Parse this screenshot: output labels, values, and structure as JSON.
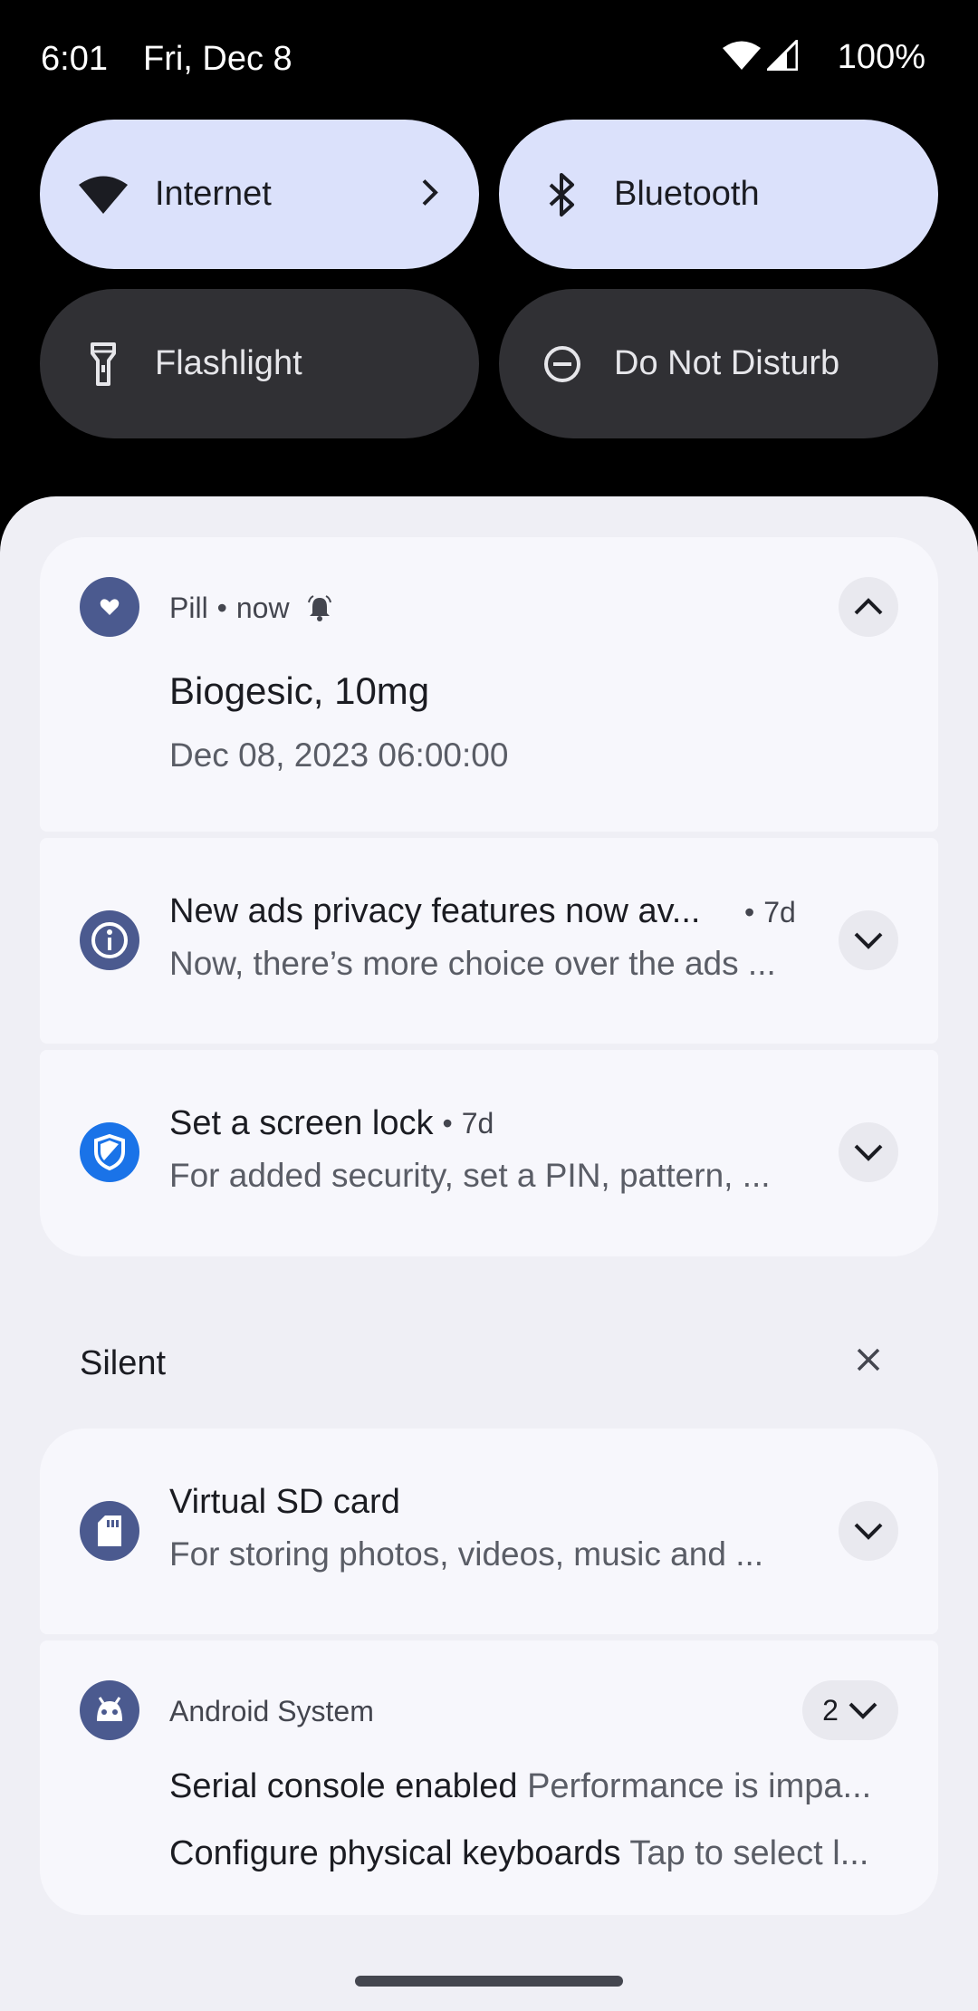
{
  "status_bar": {
    "time": "6:01",
    "date": "Fri, Dec 8",
    "battery": "100%"
  },
  "quick_settings": {
    "internet": {
      "label": "Internet",
      "icon": "wifi-icon"
    },
    "bluetooth": {
      "label": "Bluetooth",
      "icon": "bluetooth-icon"
    },
    "flashlight": {
      "label": "Flashlight",
      "icon": "flashlight-icon"
    },
    "dnd": {
      "label": "Do Not Disturb",
      "icon": "dnd-icon"
    }
  },
  "notifications": {
    "pill": {
      "app": "Pill",
      "time": "now",
      "title": "Biogesic, 10mg",
      "body": "Dec 08, 2023 06:00:00"
    },
    "ads": {
      "title": "New ads privacy features now av...",
      "time": "7d",
      "body": "Now, there’s more choice over the ads ..."
    },
    "lock": {
      "title": "Set a screen lock",
      "time": "7d",
      "body": "For added security, set a PIN, pattern, ..."
    }
  },
  "silent": {
    "label": "Silent",
    "sdcard": {
      "title": "Virtual SD card",
      "body": "For storing photos, videos, music and ..."
    },
    "android": {
      "app": "Android System",
      "count": "2",
      "line1_title": "Serial console enabled",
      "line1_body": "Performance is impa...",
      "line2_title": "Configure physical keyboards",
      "line2_body": "Tap to select l..."
    }
  },
  "colors": {
    "tile_on": "#dbe1fb",
    "tile_off": "#303034",
    "shade_bg": "#efeff5",
    "card_bg": "#f7f7fc",
    "app_icon": "#4b5a8f",
    "shield_blue": "#1a73e8"
  }
}
